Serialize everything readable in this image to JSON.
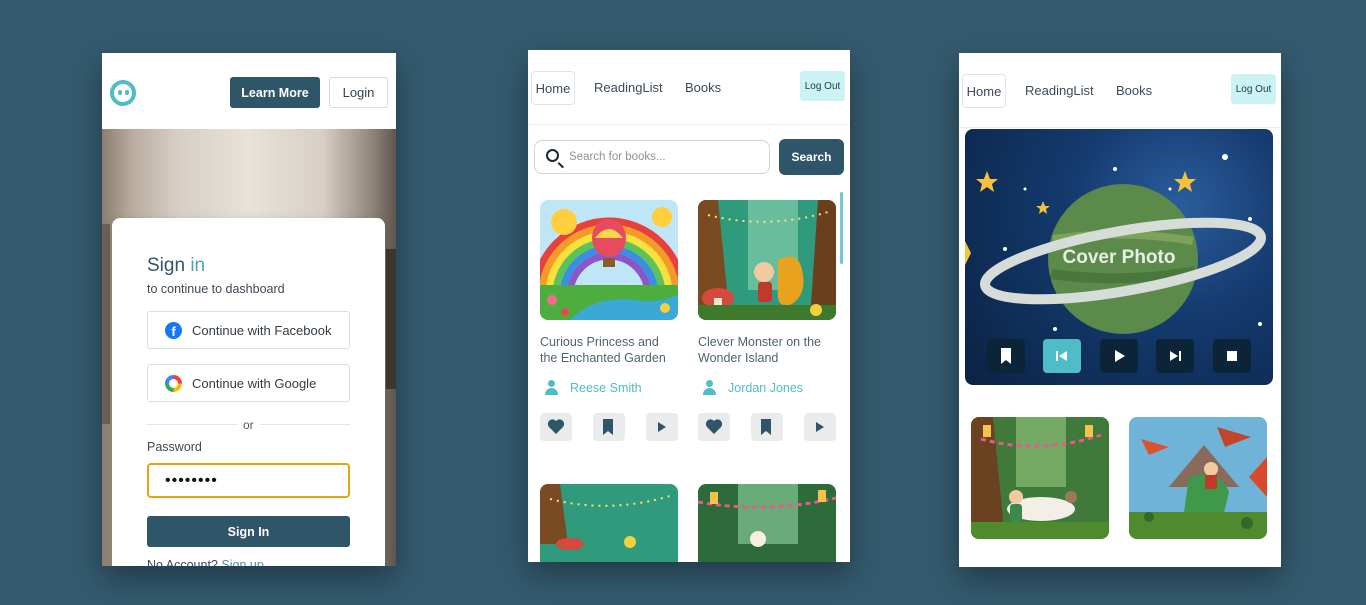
{
  "signin_screen": {
    "header": {
      "learn_more": "Learn More",
      "login": "Login"
    },
    "card": {
      "title_main": "Sign",
      "title_accent": "in",
      "subtitle": "to continue to dashboard",
      "facebook_label": "Continue with Facebook",
      "facebook_glyph": "f",
      "google_label": "Continue with Google",
      "divider": "or",
      "password_label": "Password",
      "password_value": "••••••••",
      "signin_button": "Sign In",
      "no_account": "No Account?",
      "signup_link": "Sign up"
    }
  },
  "nav": {
    "home": "Home",
    "reading_list": "ReadingList",
    "books": "Books",
    "logout": "Log Out"
  },
  "books_screen": {
    "search": {
      "placeholder": "Search for books...",
      "button": "Search"
    },
    "books": [
      {
        "title": "Curious Princess and the Enchanted Garden",
        "author": "Reese Smith"
      },
      {
        "title": "Clever Monster on the Wonder Island",
        "author": "Jordan Jones"
      }
    ]
  },
  "player_screen": {
    "cover_label": "Cover Photo",
    "controls": [
      "bookmark-icon",
      "skip-back-icon",
      "play-icon",
      "skip-forward-icon",
      "stop-icon"
    ]
  },
  "colors": {
    "background": "#345a6e",
    "primary": "#2f5568",
    "accent": "#4fbcc6",
    "logout_bg": "#cbf3f3",
    "focus_border": "#e2a514"
  }
}
